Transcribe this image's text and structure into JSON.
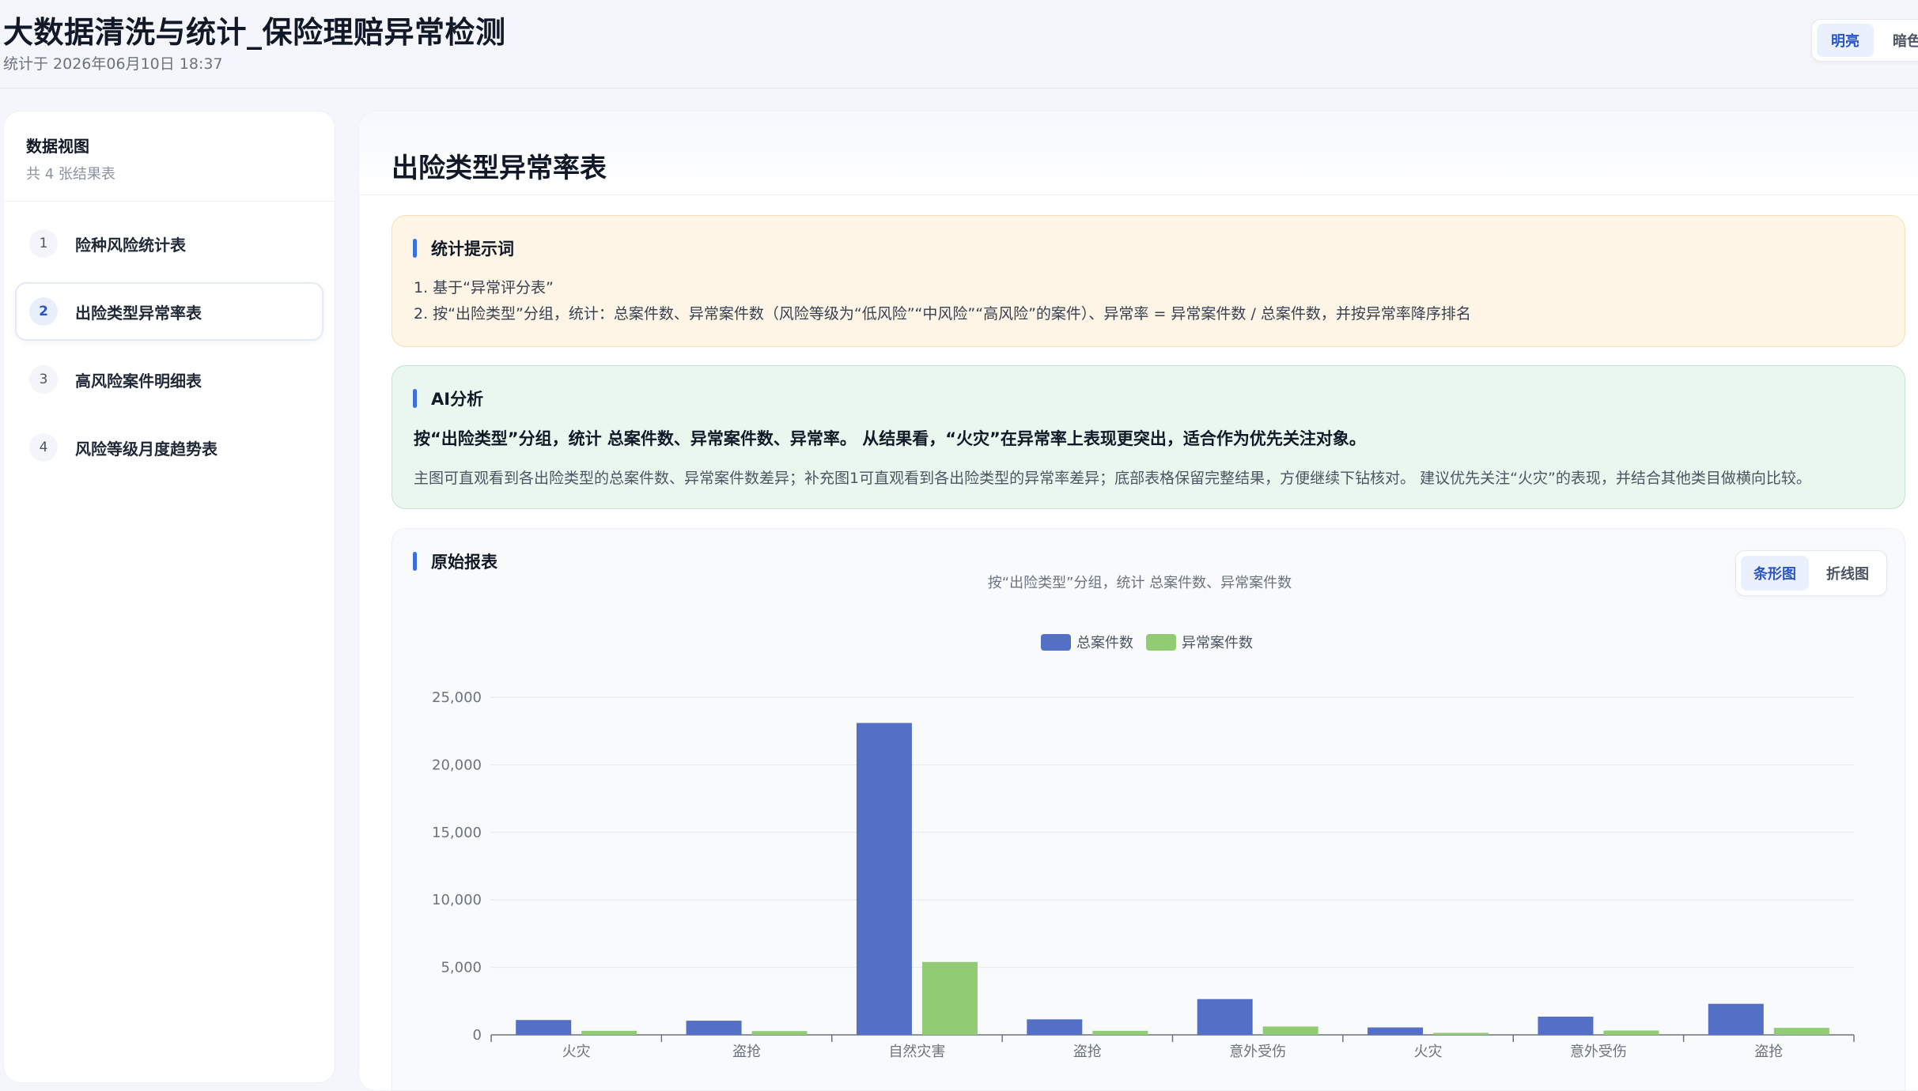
{
  "header": {
    "title": "大数据清洗与统计_保险理赔异常检测",
    "subtitle": "统计于 2026年06月10日 18:37",
    "theme_light": "明亮",
    "theme_dark": "暗色"
  },
  "sidebar": {
    "title": "数据视图",
    "subtitle": "共 4 张结果表",
    "items": [
      {
        "num": "1",
        "label": "险种风险统计表"
      },
      {
        "num": "2",
        "label": "出险类型异常率表"
      },
      {
        "num": "3",
        "label": "高风险案件明细表"
      },
      {
        "num": "4",
        "label": "风险等级月度趋势表"
      }
    ]
  },
  "main": {
    "title": "出险类型异常率表",
    "hint": {
      "heading": "统计提示词",
      "line1": "1. 基于“异常评分表”",
      "line2": "2. 按“出险类型”分组，统计：总案件数、异常案件数（风险等级为“低风险”“中风险”“高风险”的案件）、异常率 = 异常案件数 / 总案件数，并按异常率降序排名"
    },
    "ai": {
      "heading": "AI分析",
      "summary": "按“出险类型”分组，统计 总案件数、异常案件数、异常率。 从结果看，“火灾”在异常率上表现更突出，适合作为优先关注对象。",
      "detail": "主图可直观看到各出险类型的总案件数、异常案件数差异；补充图1可直观看到各出险类型的异常率差异；底部表格保留完整结果，方便继续下钻核对。 建议优先关注“火灾”的表现，并结合其他类目做横向比较。"
    },
    "report": {
      "heading": "原始报表",
      "bar_label": "条形图",
      "line_label": "折线图"
    }
  },
  "chart_data": {
    "type": "bar",
    "subtitle": "按“出险类型”分组，统计 总案件数、异常案件数",
    "categories": [
      "火灾",
      "盗抢",
      "自然灾害",
      "盗抢",
      "意外受伤",
      "火灾",
      "意外受伤",
      "盗抢"
    ],
    "series": [
      {
        "name": "总案件数",
        "color": "#5470c6",
        "values": [
          1100,
          1050,
          23100,
          1150,
          2650,
          550,
          1350,
          2300
        ]
      },
      {
        "name": "异常案件数",
        "color": "#91cc75",
        "values": [
          300,
          280,
          5400,
          300,
          620,
          150,
          320,
          520
        ]
      }
    ],
    "ylim": [
      0,
      25000
    ],
    "yticks": [
      "0",
      "5,000",
      "10,000",
      "15,000",
      "20,000",
      "25,000"
    ],
    "grid": true,
    "legend": "top-center"
  }
}
